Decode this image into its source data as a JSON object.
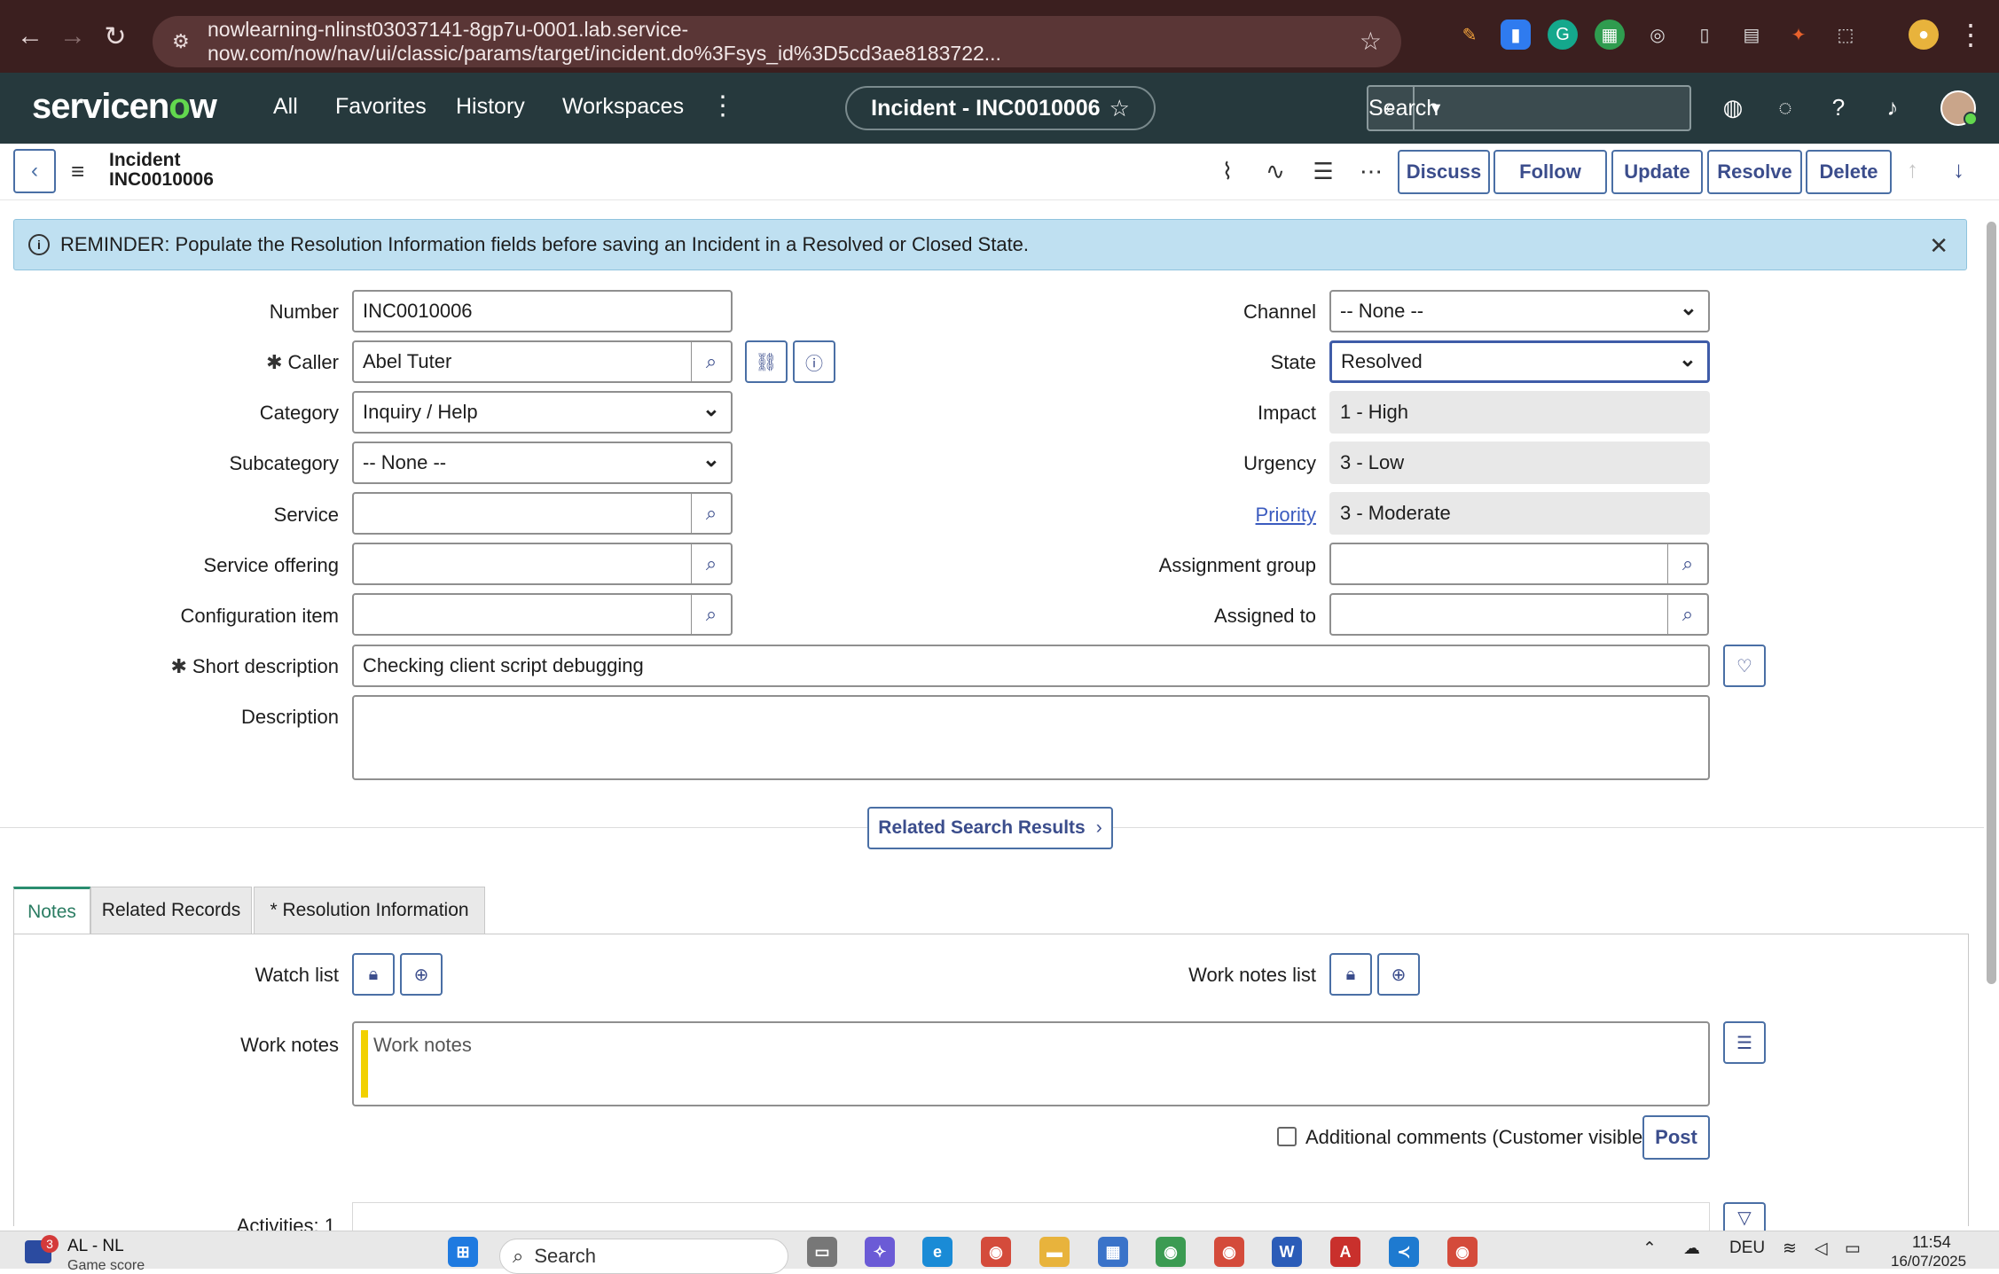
{
  "browser": {
    "url": "nowlearning-nlinst03037141-8gp7u-0001.lab.service-now.com/now/nav/ui/classic/params/target/incident.do%3Fsys_id%3D5cd3ae8183722..."
  },
  "topnav": {
    "logo_pre": "servicen",
    "logo_o": "o",
    "logo_post": "w",
    "items": [
      "All",
      "Favorites",
      "History",
      "Workspaces"
    ],
    "context_pill": "Incident - INC0010006",
    "search_label": "Search"
  },
  "form_header": {
    "type": "Incident",
    "number": "INC0010006",
    "buttons": [
      "Discuss",
      "Follow",
      "Update",
      "Resolve",
      "Delete"
    ]
  },
  "banner": {
    "text": "REMINDER: Populate the Resolution Information fields before saving an Incident in a Resolved or Closed State."
  },
  "fields": {
    "number": {
      "label": "Number",
      "value": "INC0010006"
    },
    "caller": {
      "label": "Caller",
      "value": "Abel Tuter",
      "required": "✱"
    },
    "category": {
      "label": "Category",
      "value": "Inquiry / Help"
    },
    "subcategory": {
      "label": "Subcategory",
      "value": "-- None --"
    },
    "service": {
      "label": "Service",
      "value": ""
    },
    "service_offering": {
      "label": "Service offering",
      "value": ""
    },
    "configuration_item": {
      "label": "Configuration item",
      "value": ""
    },
    "short_description": {
      "label": "Short description",
      "value": "Checking client script debugging",
      "required": "✱"
    },
    "description": {
      "label": "Description",
      "value": ""
    },
    "channel": {
      "label": "Channel",
      "value": "-- None --"
    },
    "state": {
      "label": "State",
      "value": "Resolved"
    },
    "impact": {
      "label": "Impact",
      "value": "1 - High"
    },
    "urgency": {
      "label": "Urgency",
      "value": "3 - Low"
    },
    "priority": {
      "label": "Priority",
      "value": "3 - Moderate"
    },
    "assignment_group": {
      "label": "Assignment group",
      "value": ""
    },
    "assigned_to": {
      "label": "Assigned to",
      "value": ""
    }
  },
  "related_search": "Related Search Results",
  "tabs": [
    "Notes",
    "Related Records",
    "*  Resolution Information"
  ],
  "notes": {
    "watch_list": "Watch list",
    "work_notes_list": "Work notes list",
    "work_notes_label": "Work notes",
    "work_notes_placeholder": "Work notes",
    "additional_comments": "Additional comments (Customer visible)",
    "post": "Post",
    "activities": "Activities: 1"
  },
  "taskbar": {
    "weather_badge": "3",
    "weather_text": "AL - NL",
    "weather_sub": "Game score",
    "search": "Search",
    "lang": "DEU",
    "time": "11:54",
    "date": "16/07/2025"
  }
}
